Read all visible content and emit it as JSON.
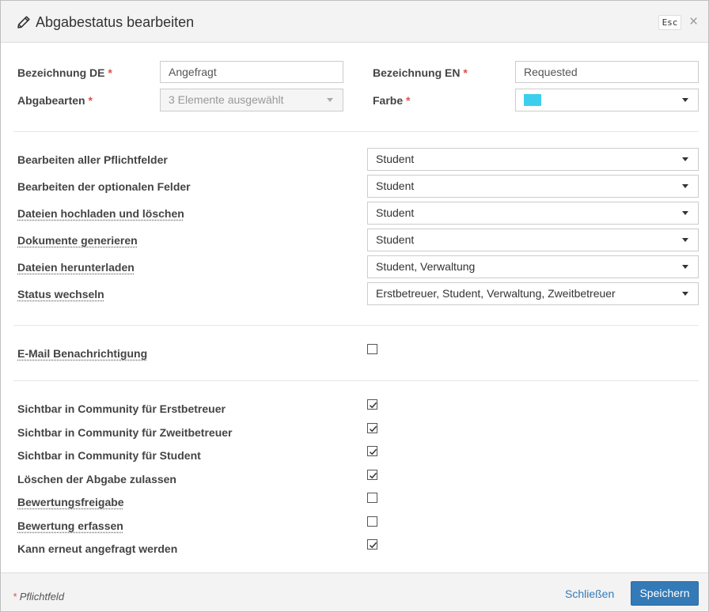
{
  "header": {
    "title": "Abgabestatus bearbeiten",
    "esc_label": "Esc",
    "close_symbol": "×"
  },
  "form": {
    "name_de": {
      "label": "Bezeichnung DE",
      "value": "Angefragt"
    },
    "name_en": {
      "label": "Bezeichnung EN",
      "value": "Requested"
    },
    "submission_types": {
      "label": "Abgabearten",
      "value": "3 Elemente ausgewählt"
    },
    "color": {
      "label": "Farbe",
      "value": "#3ccfed"
    },
    "required_mark": "*"
  },
  "permissions": [
    {
      "label": "Bearbeiten aller Pflichtfelder",
      "value": "Student",
      "dotted": false
    },
    {
      "label": "Bearbeiten der optionalen Felder",
      "value": "Student",
      "dotted": false
    },
    {
      "label": "Dateien hochladen und löschen",
      "value": "Student",
      "dotted": true
    },
    {
      "label": "Dokumente generieren",
      "value": "Student",
      "dotted": true
    },
    {
      "label": "Dateien herunterladen",
      "value": "Student, Verwaltung",
      "dotted": true
    },
    {
      "label": "Status wechseln",
      "value": "Erstbetreuer, Student, Verwaltung, Zweitbetreuer",
      "dotted": true
    }
  ],
  "notification": {
    "label": "E-Mail Benachrichtigung",
    "checked": false
  },
  "visibility": [
    {
      "label": "Sichtbar in Community für Erstbetreuer",
      "checked": true,
      "dotted": false
    },
    {
      "label": "Sichtbar in Community für Zweitbetreuer",
      "checked": true,
      "dotted": false
    },
    {
      "label": "Sichtbar in Community für Student",
      "checked": true,
      "dotted": false
    },
    {
      "label": "Löschen der Abgabe zulassen",
      "checked": true,
      "dotted": false
    },
    {
      "label": "Bewertungsfreigabe",
      "checked": false,
      "dotted": true
    },
    {
      "label": "Bewertung erfassen",
      "checked": false,
      "dotted": true
    },
    {
      "label": "Kann erneut angefragt werden",
      "checked": true,
      "dotted": false
    }
  ],
  "footer": {
    "required_note": "* Pflichtfeld",
    "close_label": "Schließen",
    "save_label": "Speichern"
  }
}
